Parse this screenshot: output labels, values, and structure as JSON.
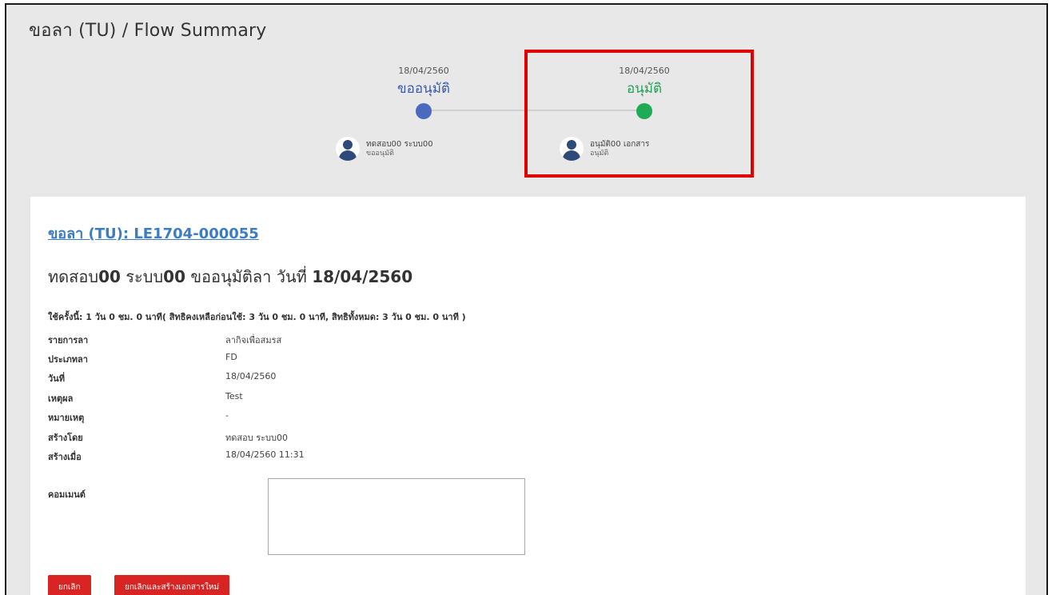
{
  "header": {
    "title": "ขอลา (TU) / Flow Summary"
  },
  "flow": {
    "steps": [
      {
        "date": "18/04/2560",
        "label": "ขออนุมัติ",
        "status_color": "#4a6abf",
        "person_name": "ทดสอบ00 ระบบ00",
        "person_role": "ขออนุมัติ"
      },
      {
        "date": "18/04/2560",
        "label": "อนุมัติ",
        "status_color": "#1faa55",
        "person_name": "อนุมัติ00 เอกสาร",
        "person_role": "อนุมัติ"
      }
    ],
    "highlight_color": "#e00000"
  },
  "document": {
    "link_text": "ขอลา (TU): LE1704-000055",
    "title_prefix": "ทดสอบ",
    "title_bold1": "00",
    "title_mid": " ระบบ",
    "title_bold2": "00",
    "title_rest": " ขออนุมัติลา วันที่ ",
    "title_date": "18/04/2560",
    "usage": "ใช้ครั้งนี้: 1 วัน 0 ชม. 0 นาที( สิทธิคงเหลือก่อนใช้: 3 วัน 0 ชม. 0 นาที, สิทธิทั้งหมด: 3 วัน 0 ชม. 0 นาที )",
    "fields": [
      {
        "label": "รายการลา",
        "value": "ลากิจเพื่อสมรส"
      },
      {
        "label": "ประเภทลา",
        "value": "FD"
      },
      {
        "label": "วันที่",
        "value": "18/04/2560"
      },
      {
        "label": "เหตุผล",
        "value": "Test"
      },
      {
        "label": "หมายเหตุ",
        "value": "-"
      },
      {
        "label": "สร้างโดย",
        "value": "ทดสอบ ระบบ00"
      },
      {
        "label": "สร้างเมื่อ",
        "value": "18/04/2560 11:31"
      }
    ],
    "comment_label": "คอมเมนต์",
    "comment_value": ""
  },
  "actions": {
    "cancel_label": "ยกเลิก",
    "cancel_recreate_label": "ยกเลิกและสร้างเอกสารใหม่",
    "button_color": "#d92424"
  }
}
